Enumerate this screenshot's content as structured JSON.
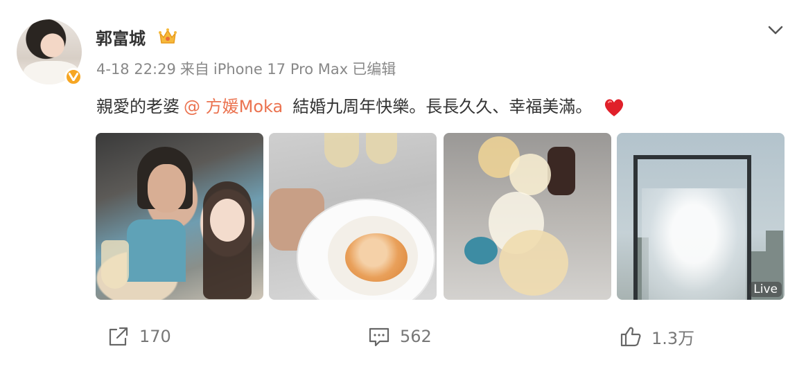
{
  "author": {
    "name": "郭富城",
    "badge": "crown-icon",
    "verified_color": "#f6a623"
  },
  "meta": {
    "time": "4-18 22:29",
    "source_prefix": "来自",
    "device": "iPhone 17 Pro Max",
    "edited": "已编辑"
  },
  "content": {
    "text_before": "親愛的老婆",
    "mention": "@ 方媛Moka",
    "text_after": "結婚九周年快樂。長長久久、幸福美滿。",
    "emoji": "heart-icon",
    "mention_color": "#eb7350"
  },
  "photos": [
    {
      "id": 1
    },
    {
      "id": 2
    },
    {
      "id": 3
    },
    {
      "id": 4,
      "badge": "Live"
    }
  ],
  "actions": {
    "share_count": "170",
    "comment_count": "562",
    "like_count": "1.3万"
  }
}
